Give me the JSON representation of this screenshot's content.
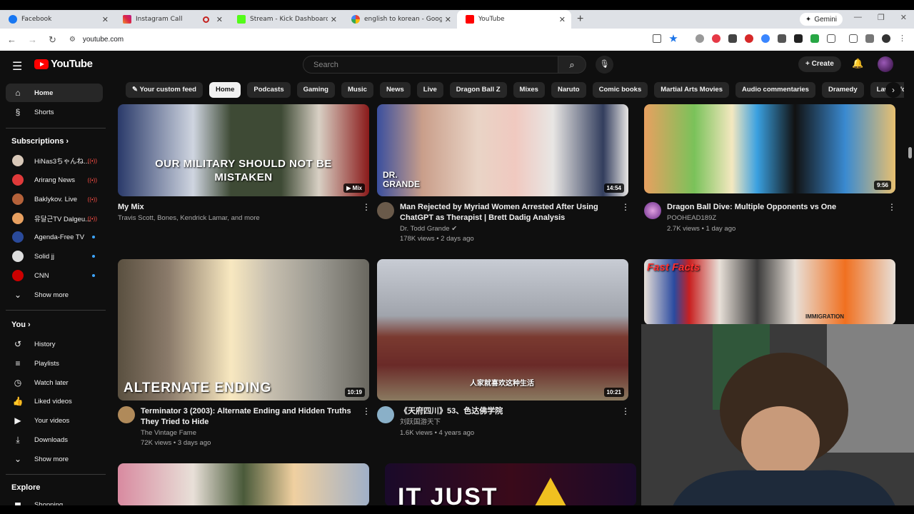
{
  "browser": {
    "tabs": [
      {
        "title": "Facebook",
        "color": "#1877f2"
      },
      {
        "title": "Instagram Call",
        "color": "#e1306c"
      },
      {
        "title": "Stream - Kick Dashboard",
        "color": "#53fc18"
      },
      {
        "title": "english to korean - Google Sea",
        "color": "#4285f4"
      },
      {
        "title": "YouTube",
        "color": "#ff0000"
      }
    ],
    "gemini_label": "Gemini",
    "url": "youtube.com"
  },
  "youtube": {
    "logo": "YouTube",
    "search_placeholder": "Search",
    "create_label": "Create",
    "chips": [
      "Your custom feed",
      "Home",
      "Podcasts",
      "Gaming",
      "Music",
      "News",
      "Live",
      "Dragon Ball Z",
      "Mixes",
      "Naruto",
      "Comic books",
      "Martial Arts Movies",
      "Audio commentaries",
      "Dramedy",
      "Law enforcement",
      "T"
    ],
    "sidebar": {
      "home": "Home",
      "shorts": "Shorts",
      "subscriptions_title": "Subscriptions",
      "subscriptions": [
        {
          "name": "HiNas3ちゃんね...",
          "status": "live",
          "color": "#d8c8b8"
        },
        {
          "name": "Arirang News",
          "status": "live",
          "color": "#e03a3a"
        },
        {
          "name": "Baklykov. Live",
          "status": "live",
          "color": "#b5623a"
        },
        {
          "name": "유달근TV Dalgeu...",
          "status": "live",
          "color": "#e8a060"
        },
        {
          "name": "Agenda-Free TV",
          "status": "new",
          "color": "#2a4a9a"
        },
        {
          "name": "Solid jj",
          "status": "new",
          "color": "#ddd"
        },
        {
          "name": "CNN",
          "status": "new",
          "color": "#cc0000"
        }
      ],
      "show_more": "Show more",
      "you_title": "You",
      "you_items": [
        "History",
        "Playlists",
        "Watch later",
        "Liked videos",
        "Your videos",
        "Downloads"
      ],
      "show_more_2": "Show more",
      "explore_title": "Explore",
      "explore_partial": "Shopping"
    },
    "videos": [
      {
        "title": "My Mix",
        "channel": "Travis Scott, Bones, Kendrick Lamar, and more",
        "badge": "Mix",
        "overlay": "OUR MILITARY SHOULD NOT BE MISTAKEN"
      },
      {
        "title": "Man Rejected by Myriad Women Arrested After Using ChatGPT as Therapist | Brett Dadig Analysis",
        "channel": "Dr. Todd Grande",
        "stats": "178K views • 2 days ago",
        "duration": "14:54",
        "overlay": "DR. GRANDE"
      },
      {
        "title": "Dragon Ball Dive: Multiple Opponents vs One",
        "channel": "POOHEAD189Z",
        "stats": "2.7K views • 1 day ago",
        "duration": "9:56"
      },
      {
        "title": "Terminator 3 (2003): Alternate Ending and Hidden Truths They Tried to Hide",
        "channel": "The Vintage Fame",
        "stats": "72K views • 3 days ago",
        "duration": "10:19",
        "overlay": "ALTERNATE ENDING"
      },
      {
        "title": "《天府四川》53、色达佛学院",
        "channel": "刘跃国游天下",
        "stats": "1.6K views • 4 years ago",
        "duration": "10:21",
        "overlay": "人家就喜欢这种生活"
      },
      {
        "title": "",
        "overlay": "Fast Facts",
        "sub_overlay": "IMMIGRATION"
      },
      {
        "overlay": "IT JUST"
      }
    ]
  }
}
